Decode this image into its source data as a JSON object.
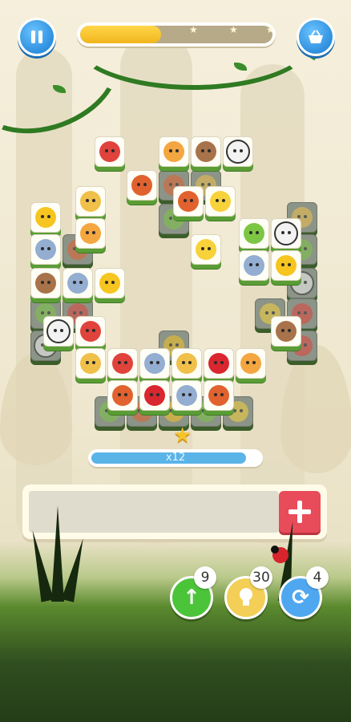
{
  "hud": {
    "pause_icon": "pause-icon",
    "shop_icon": "basket-icon",
    "level_progress": 0.42,
    "progress_stars": 3
  },
  "combo": {
    "label": "x12",
    "fill_fraction": 0.92
  },
  "tray": {
    "slots_filled": 0,
    "add_icon": "plus-icon"
  },
  "powerups": [
    {
      "name": "undo",
      "icon": "undo-arrow-icon",
      "count": "9",
      "color": "#4cc43a"
    },
    {
      "name": "hint",
      "icon": "lightbulb-icon",
      "count": "30",
      "color": "#f3cf57"
    },
    {
      "name": "shuffle",
      "icon": "shuffle-icon",
      "count": "4",
      "color": "#4fa7f0"
    }
  ],
  "animals": {
    "chick": "#f6c51f",
    "parrot": "#e0433c",
    "tiger": "#f4a640",
    "bear": "#a8734a",
    "panda": "#f2f2f2",
    "fox": "#e1622e",
    "giraffe": "#f0c04a",
    "bee": "#f7d23a",
    "frog": "#7cc644",
    "elephant": "#93aed1",
    "ladybug": "#d9262f",
    "lion": "#e8a23b"
  },
  "tiles": [
    {
      "a": "parrot"
    },
    {
      "a": "tiger"
    },
    {
      "a": "bear"
    },
    {
      "a": "panda"
    },
    {
      "a": "fox"
    },
    {
      "a": "fox",
      "dim": true
    },
    {
      "a": "giraffe",
      "dim": true
    },
    {
      "a": "fox"
    },
    {
      "a": "bee"
    },
    {
      "a": "frog",
      "dim": true
    },
    {
      "a": "giraffe"
    },
    {
      "a": "chick"
    },
    {
      "a": "tiger"
    },
    {
      "a": "elephant"
    },
    {
      "a": "fox",
      "dim": true
    },
    {
      "a": "bee"
    },
    {
      "a": "giraffe",
      "dim": true
    },
    {
      "a": "frog"
    },
    {
      "a": "panda"
    },
    {
      "a": "frog",
      "dim": true
    },
    {
      "a": "elephant"
    },
    {
      "a": "chick"
    },
    {
      "a": "panda",
      "dim": true
    },
    {
      "a": "bear"
    },
    {
      "a": "elephant"
    },
    {
      "a": "chick"
    },
    {
      "a": "frog",
      "dim": true
    },
    {
      "a": "parrot",
      "dim": true
    },
    {
      "a": "bee",
      "dim": true
    },
    {
      "a": "parrot",
      "dim": true
    },
    {
      "a": "panda"
    },
    {
      "a": "parrot"
    },
    {
      "a": "panda",
      "dim": true
    },
    {
      "a": "bear"
    },
    {
      "a": "parrot",
      "dim": true
    },
    {
      "a": "giraffe"
    },
    {
      "a": "parrot"
    },
    {
      "a": "elephant"
    },
    {
      "a": "giraffe"
    },
    {
      "a": "ladybug"
    },
    {
      "a": "tiger"
    },
    {
      "a": "fox"
    },
    {
      "a": "ladybug"
    },
    {
      "a": "elephant"
    },
    {
      "a": "fox"
    },
    {
      "a": "frog",
      "dim": true
    },
    {
      "a": "fox",
      "dim": true
    },
    {
      "a": "chick",
      "dim": true
    },
    {
      "a": "frog",
      "dim": true
    },
    {
      "a": "bee",
      "dim": true
    },
    {
      "a": "chick",
      "dim": true
    }
  ]
}
